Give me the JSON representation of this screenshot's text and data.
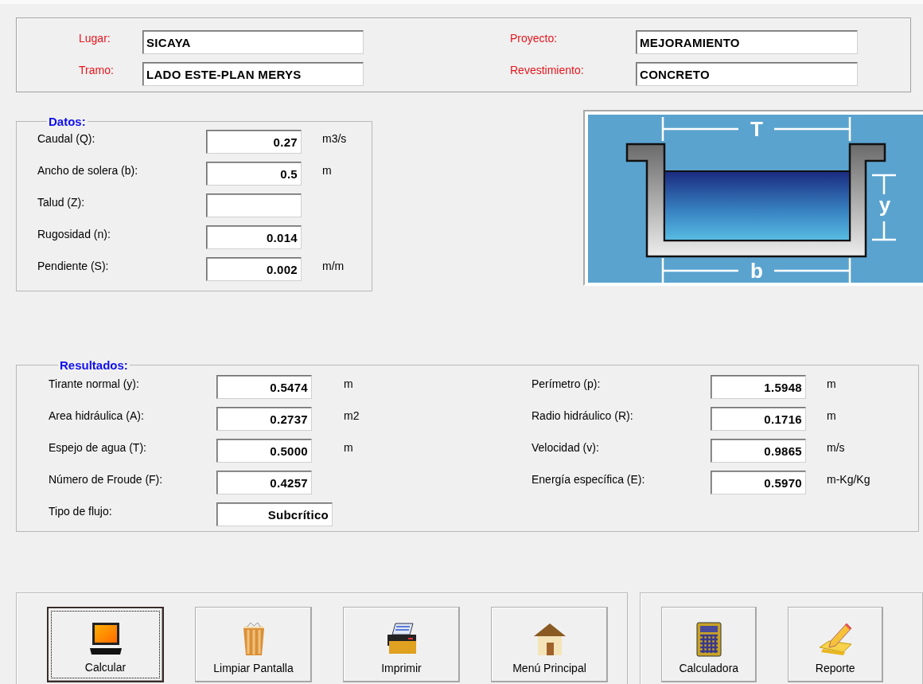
{
  "header": {
    "fields": [
      {
        "label": "Lugar:",
        "value": "SICAYA"
      },
      {
        "label": "Proyecto:",
        "value": "MEJORAMIENTO"
      },
      {
        "label": "Tramo:",
        "value": "LADO ESTE-PLAN MERYS"
      },
      {
        "label": "Revestimiento:",
        "value": "CONCRETO"
      }
    ]
  },
  "datos": {
    "title": "Datos:",
    "rows": [
      {
        "label": "Caudal (Q):",
        "value": "0.27",
        "unit": "m3/s"
      },
      {
        "label": "Ancho de solera (b):",
        "value": "0.5",
        "unit": "m"
      },
      {
        "label": "Talud (Z):"
      },
      {
        "label": "Rugosidad (n):",
        "value": "0.014"
      },
      {
        "label": "Pendiente (S):",
        "value": "0.002",
        "unit": "m/m"
      }
    ]
  },
  "diagram": {
    "top_label": "T",
    "depth_label": "y",
    "bottom_label": "b"
  },
  "resultados": {
    "title": "Resultados:",
    "left_rows": [
      {
        "label": "Tirante normal (y):",
        "value": "0.5474",
        "unit": "m"
      },
      {
        "label": "Area hidráulica (A):",
        "value": "0.2737",
        "unit": "m2"
      },
      {
        "label": "Espejo de agua (T):",
        "value": "0.5000",
        "unit": "m"
      },
      {
        "label": "Número de Froude (F):",
        "value": "0.4257"
      },
      {
        "label": "Tipo de flujo:",
        "value": "Subcrítico",
        "kind": "wide"
      }
    ],
    "right_rows": [
      {
        "label": "Perímetro (p):",
        "value": "1.5948",
        "unit": "m"
      },
      {
        "label": "Radio hidráulico (R):",
        "value": "0.1716",
        "unit": "m"
      },
      {
        "label": "Velocidad (v):",
        "value": "0.9865",
        "unit": "m/s"
      },
      {
        "label": "Energía específica (E):",
        "value": "0.5970",
        "unit": "m-Kg/Kg"
      }
    ]
  },
  "actions": [
    {
      "label": "Calcular",
      "kind": "laptop",
      "focused": true
    },
    {
      "label": "Limpiar Pantalla",
      "kind": "trash",
      "focused": false
    },
    {
      "label": "Imprimir",
      "kind": "printer",
      "focused": false
    },
    {
      "label": "Menú Principal",
      "kind": "house",
      "focused": false
    }
  ],
  "tools": [
    {
      "label": "Calculadora",
      "kind": "calculator",
      "focused": false
    },
    {
      "label": "Reporte",
      "kind": "pencil",
      "focused": false
    }
  ]
}
